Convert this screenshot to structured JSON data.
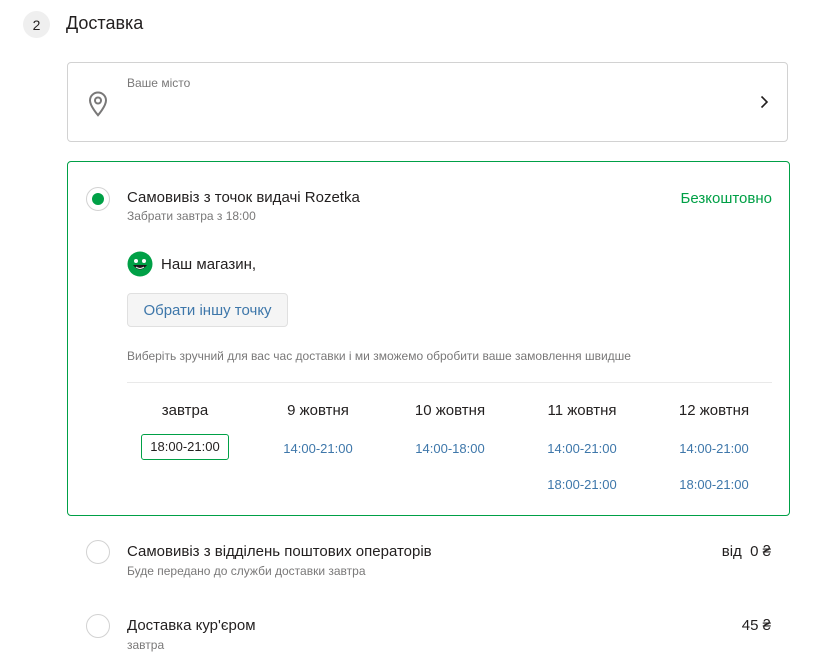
{
  "section": {
    "step_number": "2",
    "title": "Доставка"
  },
  "city": {
    "label": "Ваше місто",
    "icons": [
      "location-pin-icon",
      "chevron-right-icon"
    ]
  },
  "options": [
    {
      "title": "Самовивіз з точок видачі Rozetka",
      "subtitle": "Забрати завтра з 18:00",
      "price": "Безкоштовно",
      "selected": true,
      "store_name": "Наш магазин,",
      "choose_button": "Обрати іншу точку",
      "hint": "Виберіть зручний для вас час доставки і ми зможемо обробити ваше замовлення швидше",
      "schedule": [
        {
          "day": "завтра",
          "slots": [
            "18:00-21:00"
          ],
          "selected_slot": "18:00-21:00"
        },
        {
          "day": "9 жовтня",
          "slots": [
            "14:00-21:00"
          ]
        },
        {
          "day": "10 жовтня",
          "slots": [
            "14:00-18:00"
          ]
        },
        {
          "day": "11 жовтня",
          "slots": [
            "14:00-21:00",
            "18:00-21:00"
          ]
        },
        {
          "day": "12 жовтня",
          "slots": [
            "14:00-21:00",
            "18:00-21:00"
          ]
        }
      ]
    },
    {
      "title": "Самовивіз з відділень поштових операторів",
      "subtitle": "Буде передано до служби доставки завтра",
      "price": "від  0 ₴",
      "selected": false
    },
    {
      "title": "Доставка кур'єром",
      "subtitle": "завтра",
      "price": "45 ₴",
      "selected": false
    }
  ],
  "colors": {
    "accent_green": "#00a046",
    "link_blue": "#3e77aa",
    "muted_text": "#797878",
    "border": "#d2d2d2"
  }
}
